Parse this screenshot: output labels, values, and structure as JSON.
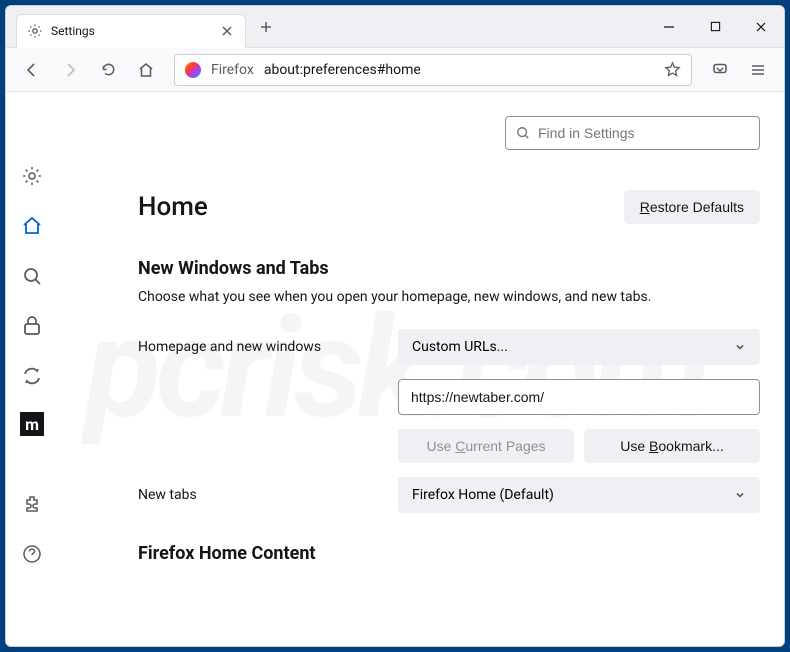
{
  "window": {
    "tab_title": "Settings",
    "address_brand": "Firefox",
    "address_url": "about:preferences#home"
  },
  "search": {
    "placeholder": "Find in Settings"
  },
  "header": {
    "title": "Home",
    "restore_label_pre": "R",
    "restore_label_post": "estore Defaults"
  },
  "section": {
    "title": "New Windows and Tabs",
    "desc": "Choose what you see when you open your homepage, new windows, and new tabs."
  },
  "homepage": {
    "label": "Homepage and new windows",
    "select_value": "Custom URLs...",
    "url_value": "https://newtaber.com/",
    "use_current_pre": "C",
    "use_current_p1": "Use ",
    "use_current_p2": "urrent Pages",
    "use_bookmark_pre": "B",
    "use_bookmark_p1": "Use ",
    "use_bookmark_p2": "ookmark..."
  },
  "newtabs": {
    "label": "New tabs",
    "select_value": "Firefox Home (Default)"
  },
  "section2": {
    "title": "Firefox Home Content"
  },
  "watermark": "pcrisk.com"
}
